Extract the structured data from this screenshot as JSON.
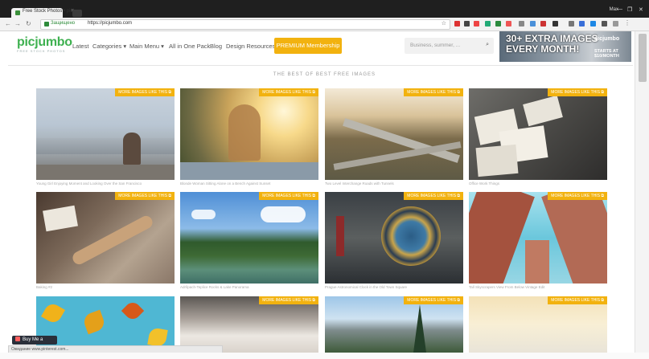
{
  "browser": {
    "tab_title": "Free Stock Photos • picj…",
    "tab_close": "×",
    "user": "Max",
    "secure_label": "Защищено",
    "url": "https://picjumbo.com",
    "nav_icons": [
      "back-icon",
      "forward-icon",
      "reload-icon"
    ],
    "window_controls": [
      "—",
      "❐",
      "✕"
    ]
  },
  "site": {
    "logo": "picjumbo",
    "tagline": "FREE STOCK PHOTOS",
    "menu": [
      "Latest",
      "Categories ▾",
      "Main Menu ▾",
      "All in One Pack",
      "Blog",
      "Design Resources"
    ],
    "premium_button": "PREMIUM Membership",
    "search_placeholder": "Business, summer, ...",
    "banner": {
      "headline_1": "30+ EXTRA IMAGES",
      "headline_2": "EVERY MONTH!",
      "brand": "picjumbo",
      "price": "STARTS AT $10/MONTH"
    },
    "section_title": "THE BEST OF BEST FREE IMAGES",
    "more_label": "MORE IMAGES LIKE THIS ⧉"
  },
  "photos": [
    {
      "caption": "Young Girl Enjoying Moment and Looking Over the San Francisco"
    },
    {
      "caption": "Blonde Woman Sitting Alone on a Bench Against Sunset"
    },
    {
      "caption": "Two Level Interchange Roads with Tunnels"
    },
    {
      "caption": "Office Work Things"
    },
    {
      "caption": "Baking #2"
    },
    {
      "caption": "Adršpach-Teplice Rocks & Lake Panorama"
    },
    {
      "caption": "Prague Astronomical Clock in the Old Town Square"
    },
    {
      "caption": "Tall Skyscrapers View From Below Vintage Edit"
    },
    {
      "caption": ""
    },
    {
      "caption": ""
    },
    {
      "caption": ""
    },
    {
      "caption": ""
    }
  ],
  "footer": {
    "buy_coffee": "Buy Me a Coffee",
    "status_bar": "Ожидание www.pinterest.com..."
  }
}
